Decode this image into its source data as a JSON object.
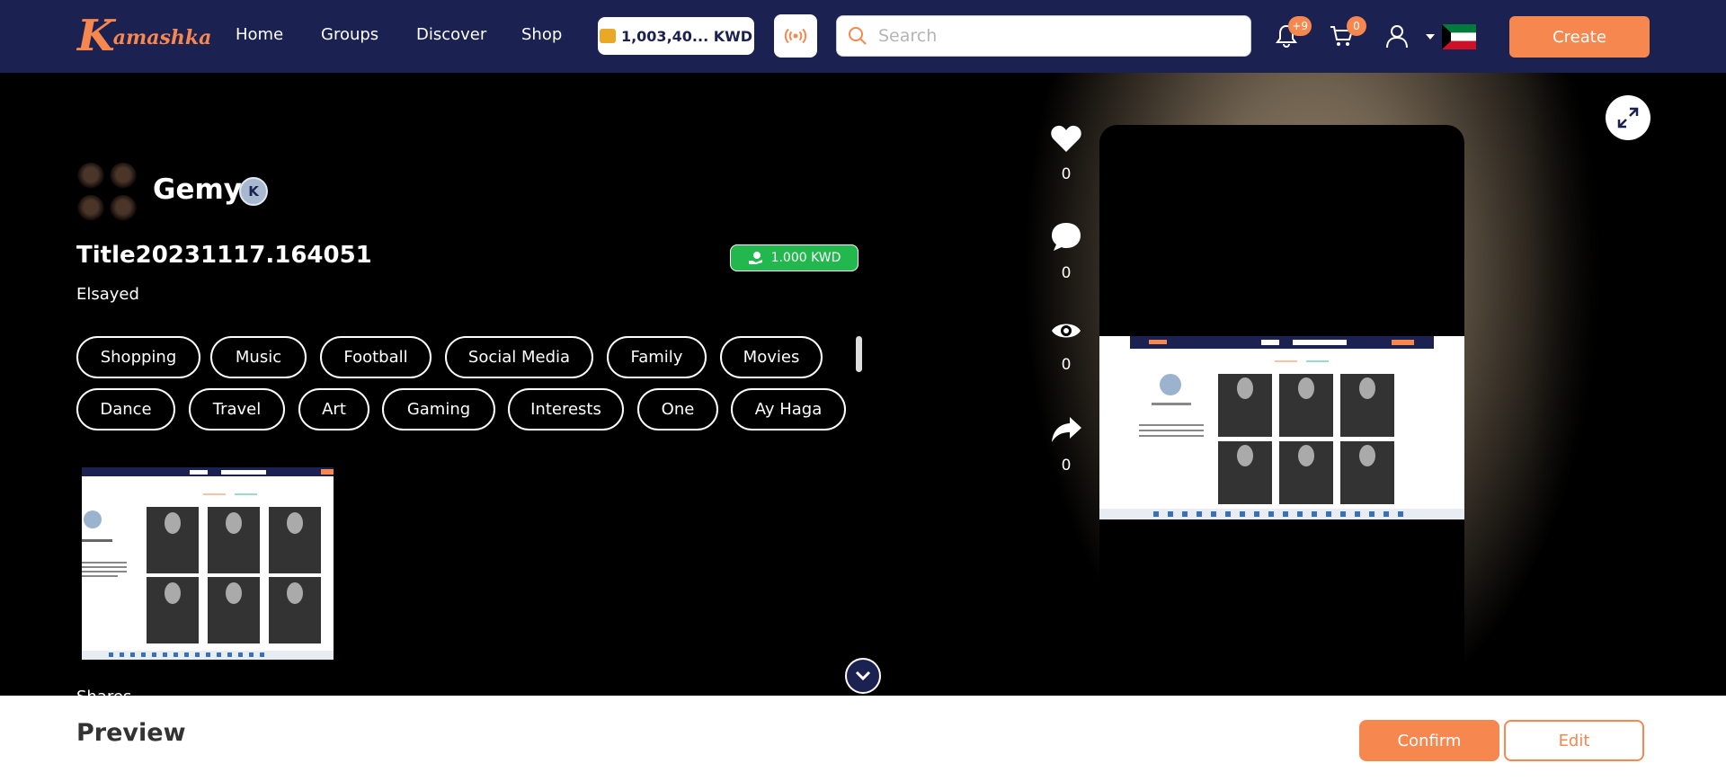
{
  "app": {
    "logo_k": "K",
    "logo_rest": "amashka",
    "brand_color": "#f5874f",
    "nav_color": "#1b2150"
  },
  "nav": {
    "links": [
      "Home",
      "Groups",
      "Discover",
      "Shop"
    ],
    "wallet": "1,003,40... KWD",
    "search_placeholder": "Search",
    "notifications_badge": "+9",
    "cart_badge": "0",
    "create_label": "Create"
  },
  "post": {
    "username": "Gemy",
    "verified_glyph": "K",
    "title": "Title20231117.164051",
    "subtitle": "Elsayed",
    "price": "1.000 KWD",
    "tags": [
      "Shopping",
      "Music",
      "Football",
      "Social Media",
      "Family",
      "Movies",
      "Dance",
      "Travel",
      "Art",
      "Gaming",
      "Interests",
      "One",
      "Ay Haga"
    ],
    "shares_label": "Shares"
  },
  "actions": {
    "likes": "0",
    "comments": "0",
    "views": "0",
    "shares": "0"
  },
  "footer": {
    "preview_label": "Preview",
    "confirm_label": "Confirm",
    "edit_label": "Edit"
  }
}
